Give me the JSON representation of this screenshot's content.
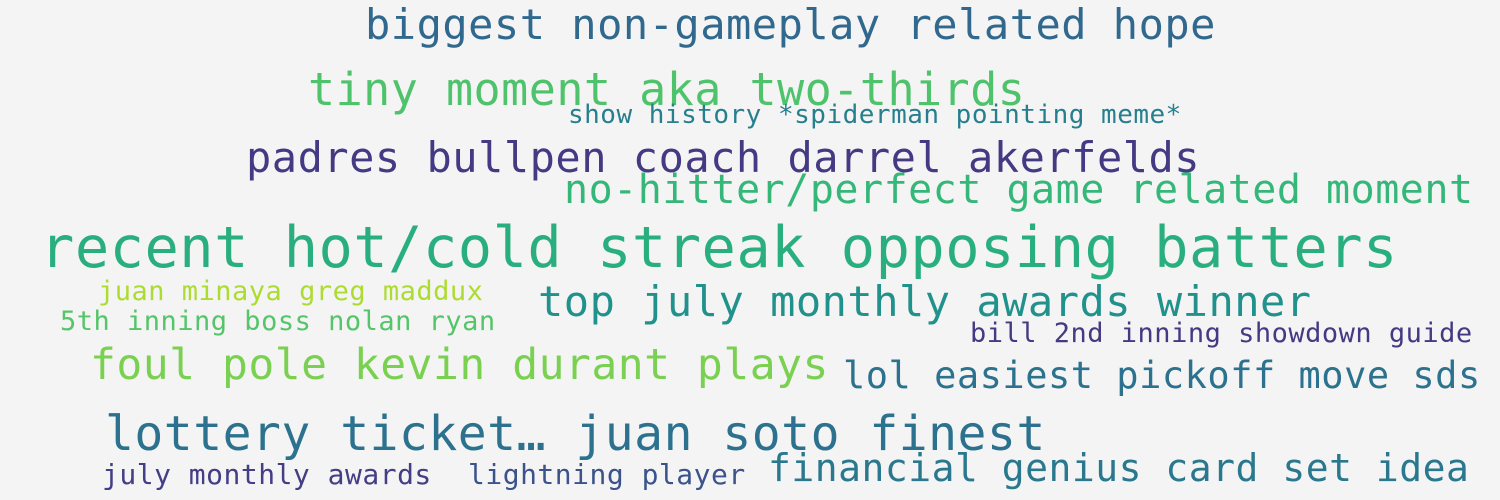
{
  "background_color": "#f4f4f4",
  "phrases": [
    {
      "text": "biggest non-gameplay related hope",
      "color": "#31688e"
    },
    {
      "text": "tiny moment aka two-thirds",
      "color": "#4ec36b"
    },
    {
      "text": "show history *spiderman pointing meme*",
      "color": "#277f8e"
    },
    {
      "text": "padres bullpen coach darrel akerfelds",
      "color": "#443983"
    },
    {
      "text": "no-hitter/perfect game related moment",
      "color": "#35b779"
    },
    {
      "text": "recent hot/cold streak opposing batters",
      "color": "#29af7f"
    },
    {
      "text": "juan minaya greg maddux",
      "color": "#addc30"
    },
    {
      "text": "top july monthly awards winner",
      "color": "#21918c"
    },
    {
      "text": "5th inning boss nolan ryan",
      "color": "#54c568"
    },
    {
      "text": "bill 2nd inning showdown guide",
      "color": "#443983"
    },
    {
      "text": "foul pole kevin durant plays",
      "color": "#7ad151"
    },
    {
      "text": "lol easiest pickoff move sds",
      "color": "#2c728e"
    },
    {
      "text": "lottery ticket… juan soto finest",
      "color": "#2c728e"
    },
    {
      "text": "july monthly awards",
      "color": "#433e85"
    },
    {
      "text": "lightning player",
      "color": "#3b528b"
    },
    {
      "text": "financial genius card set idea",
      "color": "#2a788e"
    }
  ]
}
